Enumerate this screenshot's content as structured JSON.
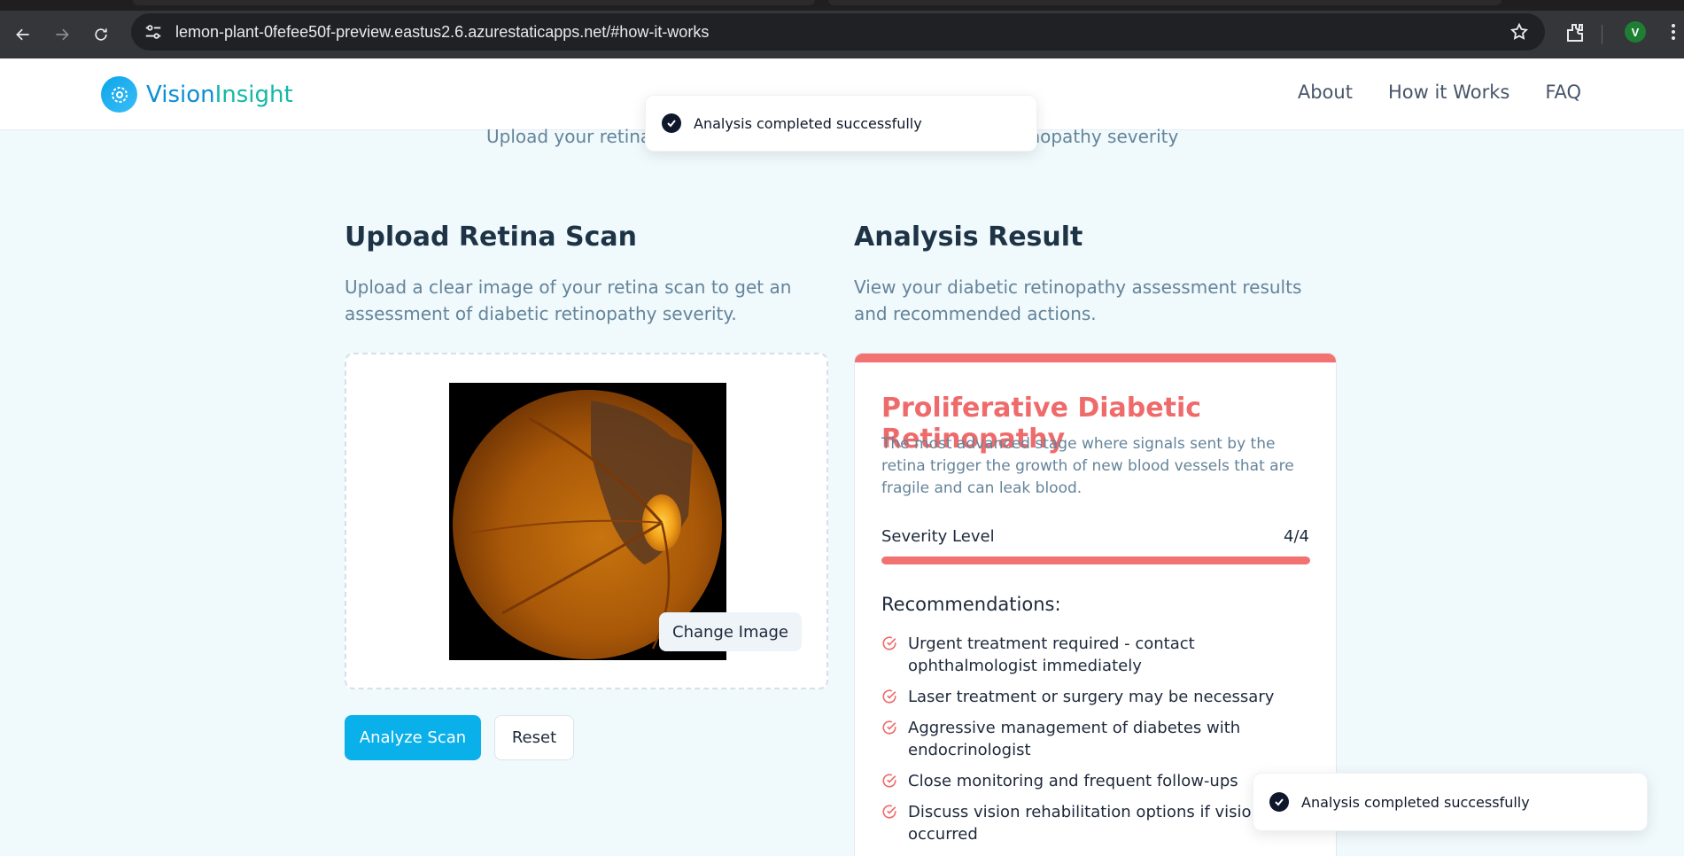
{
  "browser": {
    "url": "lemon-plant-0fefee50f-preview.eastus2.6.azurestaticapps.net/#how-it-works",
    "profile_initial": "V"
  },
  "site": {
    "logo_part1": "Vision",
    "logo_part2": "Insight",
    "nav": [
      "About",
      "How it Works",
      "FAQ"
    ],
    "hero_subtitle": "Upload your retina scan to get an assessment of diabetic retinopathy severity"
  },
  "toasts": {
    "top": "Analysis completed successfully",
    "bottom": "Analysis completed successfully"
  },
  "upload": {
    "title": "Upload Retina Scan",
    "description": "Upload a clear image of your retina scan to get an assessment of diabetic retinopathy severity.",
    "change_image": "Change Image",
    "analyze": "Analyze Scan",
    "reset": "Reset"
  },
  "result": {
    "title": "Analysis Result",
    "description": "View your diabetic retinopathy assessment results and recommended actions.",
    "diagnosis": "Proliferative Diabetic Retinopathy",
    "diagnosis_description": "The most advanced stage where signals sent by the retina trigger the growth of new blood vessels that are fragile and can leak blood.",
    "severity_label": "Severity Level",
    "severity_value": "4/4",
    "severity_fraction": 1.0,
    "accent_color": "#f27272",
    "recommendations_title": "Recommendations:",
    "recommendations": [
      "Urgent treatment required - contact ophthalmologist immediately",
      "Laser treatment or surgery may be necessary",
      "Aggressive management of diabetes with endocrinologist",
      "Close monitoring and frequent follow-ups",
      "Discuss vision rehabilitation options if vision loss occurred"
    ]
  }
}
